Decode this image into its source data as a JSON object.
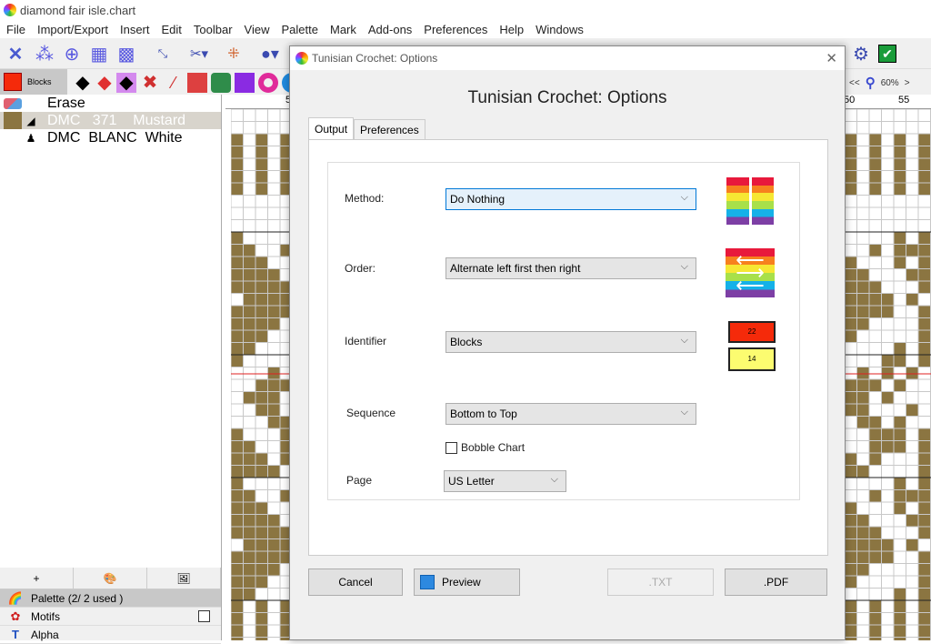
{
  "window": {
    "title": "diamond fair isle.chart"
  },
  "menu": [
    "File",
    "Import/Export",
    "Insert",
    "Edit",
    "Toolbar",
    "View",
    "Palette",
    "Mark",
    "Add-ons",
    "Preferences",
    "Help",
    "Windows"
  ],
  "toolbar2": {
    "current_symbol_label": "Blocks"
  },
  "sidebar": {
    "rows": [
      {
        "label": "Erase",
        "icon": "eraser-icon"
      },
      {
        "label": "DMC   371    Mustard",
        "color": "#8b7541",
        "marker": "◢",
        "selected": true
      },
      {
        "label": "DMC  BLANC  White",
        "color": "#ffffff",
        "marker": "♟",
        "selected": false
      }
    ],
    "tools": [
      "+",
      "🎨",
      "🖼"
    ],
    "sections": [
      {
        "label": "Palette (2/ 2 used )",
        "icon": "palette-icon"
      },
      {
        "label": "Motifs",
        "icon": "motifs-icon"
      },
      {
        "label": "Alpha",
        "icon": "alpha-icon"
      }
    ]
  },
  "chart": {
    "zoom_label": "60%",
    "ruler_labels": [
      "5",
      "50",
      "55"
    ],
    "colors": {
      "fill": "#8b7541",
      "empty": "#ffffff",
      "grid": "#c8c8c8",
      "center": "#e02020"
    }
  },
  "dialog": {
    "title": "Tunisian Crochet: Options",
    "heading": "Tunisian Crochet: Options",
    "tabs": [
      "Output",
      "Preferences"
    ],
    "fields": {
      "method": {
        "label": "Method:",
        "value": "Do Nothing"
      },
      "order": {
        "label": "Order:",
        "value": "Alternate left first then right"
      },
      "identifier": {
        "label": "Identifier",
        "value": "Blocks"
      },
      "sequence": {
        "label": "Sequence",
        "value": "Bottom to Top"
      },
      "bobble": {
        "label": "Bobble Chart",
        "checked": false
      },
      "page": {
        "label": "Page",
        "value": "US Letter"
      }
    },
    "identifier_preview": {
      "top": "22",
      "bottom": "14"
    },
    "buttons": {
      "cancel": "Cancel",
      "preview": "Preview",
      "txt": ".TXT",
      "pdf": ".PDF"
    }
  }
}
